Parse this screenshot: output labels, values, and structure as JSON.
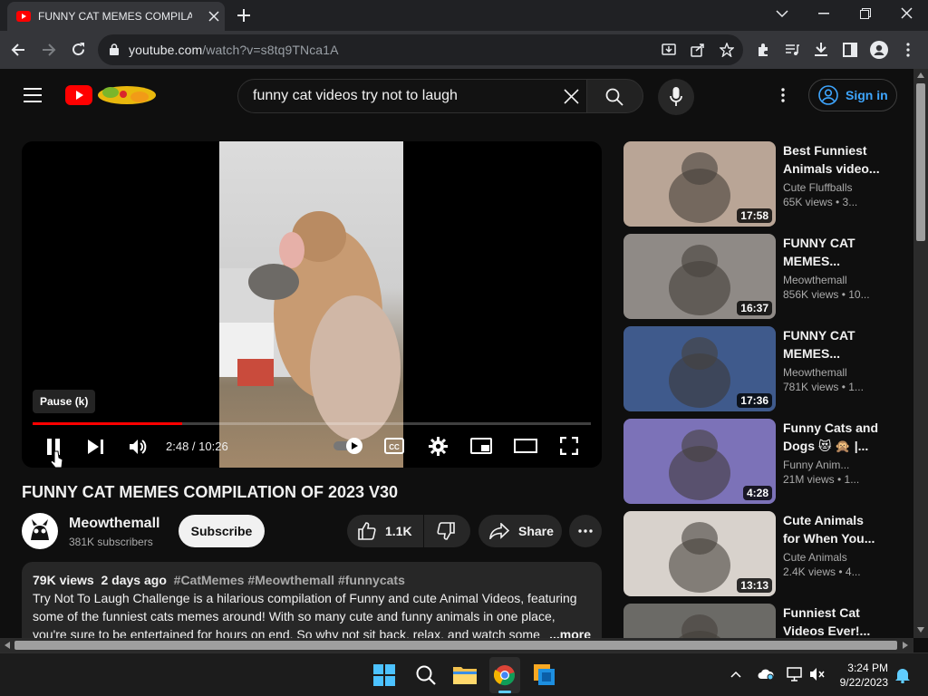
{
  "browser": {
    "tab_title": "FUNNY CAT MEMES COMPILATIO",
    "url_host": "youtube.com",
    "url_path": "/watch?v=s8tq9TNca1A"
  },
  "youtube": {
    "search_query": "funny cat videos try not to laugh",
    "sign_in": "Sign in",
    "player": {
      "tooltip": "Pause (k)",
      "time": "2:48 / 10:26",
      "progress": 0.268
    },
    "video": {
      "title": "FUNNY CAT MEMES COMPILATION OF 2023 V30",
      "channel": "Meowthemall",
      "subscribers": "381K subscribers",
      "subscribe": "Subscribe",
      "likes": "1.1K",
      "share": "Share"
    },
    "description": {
      "views": "79K views",
      "date": "2 days ago",
      "tags": "#CatMemes #Meowthemall #funnycats",
      "text": "Try Not To Laugh Challenge is a hilarious compilation of Funny and cute Animal Videos, featuring some of the funniest cats memes around! With so many cute and funny animals in one place, you're sure to be entertained for hours on end. So why not sit back, relax, and watch some c",
      "more": "...more"
    },
    "related": [
      {
        "title": "Best Funniest Animals video...",
        "channel": "Cute Fluffballs",
        "meta": "65K views • 3...",
        "duration": "17:58",
        "bg": "#b9a596"
      },
      {
        "title": "FUNNY CAT MEMES...",
        "channel": "Meowthemall",
        "meta": "856K views • 10...",
        "duration": "16:37",
        "bg": "#8f8a86"
      },
      {
        "title": "FUNNY CAT MEMES...",
        "channel": "Meowthemall",
        "meta": "781K views • 1...",
        "duration": "17:36",
        "bg": "#3f5a8c"
      },
      {
        "title": "Funny Cats and Dogs 😻 🙊 |...",
        "channel": "Funny Anim...",
        "meta": "21M views • 1...",
        "duration": "4:28",
        "bg": "#7c72b8"
      },
      {
        "title": "Cute Animals for When You...",
        "channel": "Cute Animals",
        "meta": "2.4K views • 4...",
        "duration": "13:13",
        "bg": "#d8d2cc"
      },
      {
        "title": "Funniest Cat Videos Ever!...",
        "channel": "",
        "meta": "",
        "duration": "",
        "bg": "#6b6a66"
      }
    ]
  },
  "taskbar": {
    "time": "3:24 PM",
    "date": "9/22/2023"
  }
}
